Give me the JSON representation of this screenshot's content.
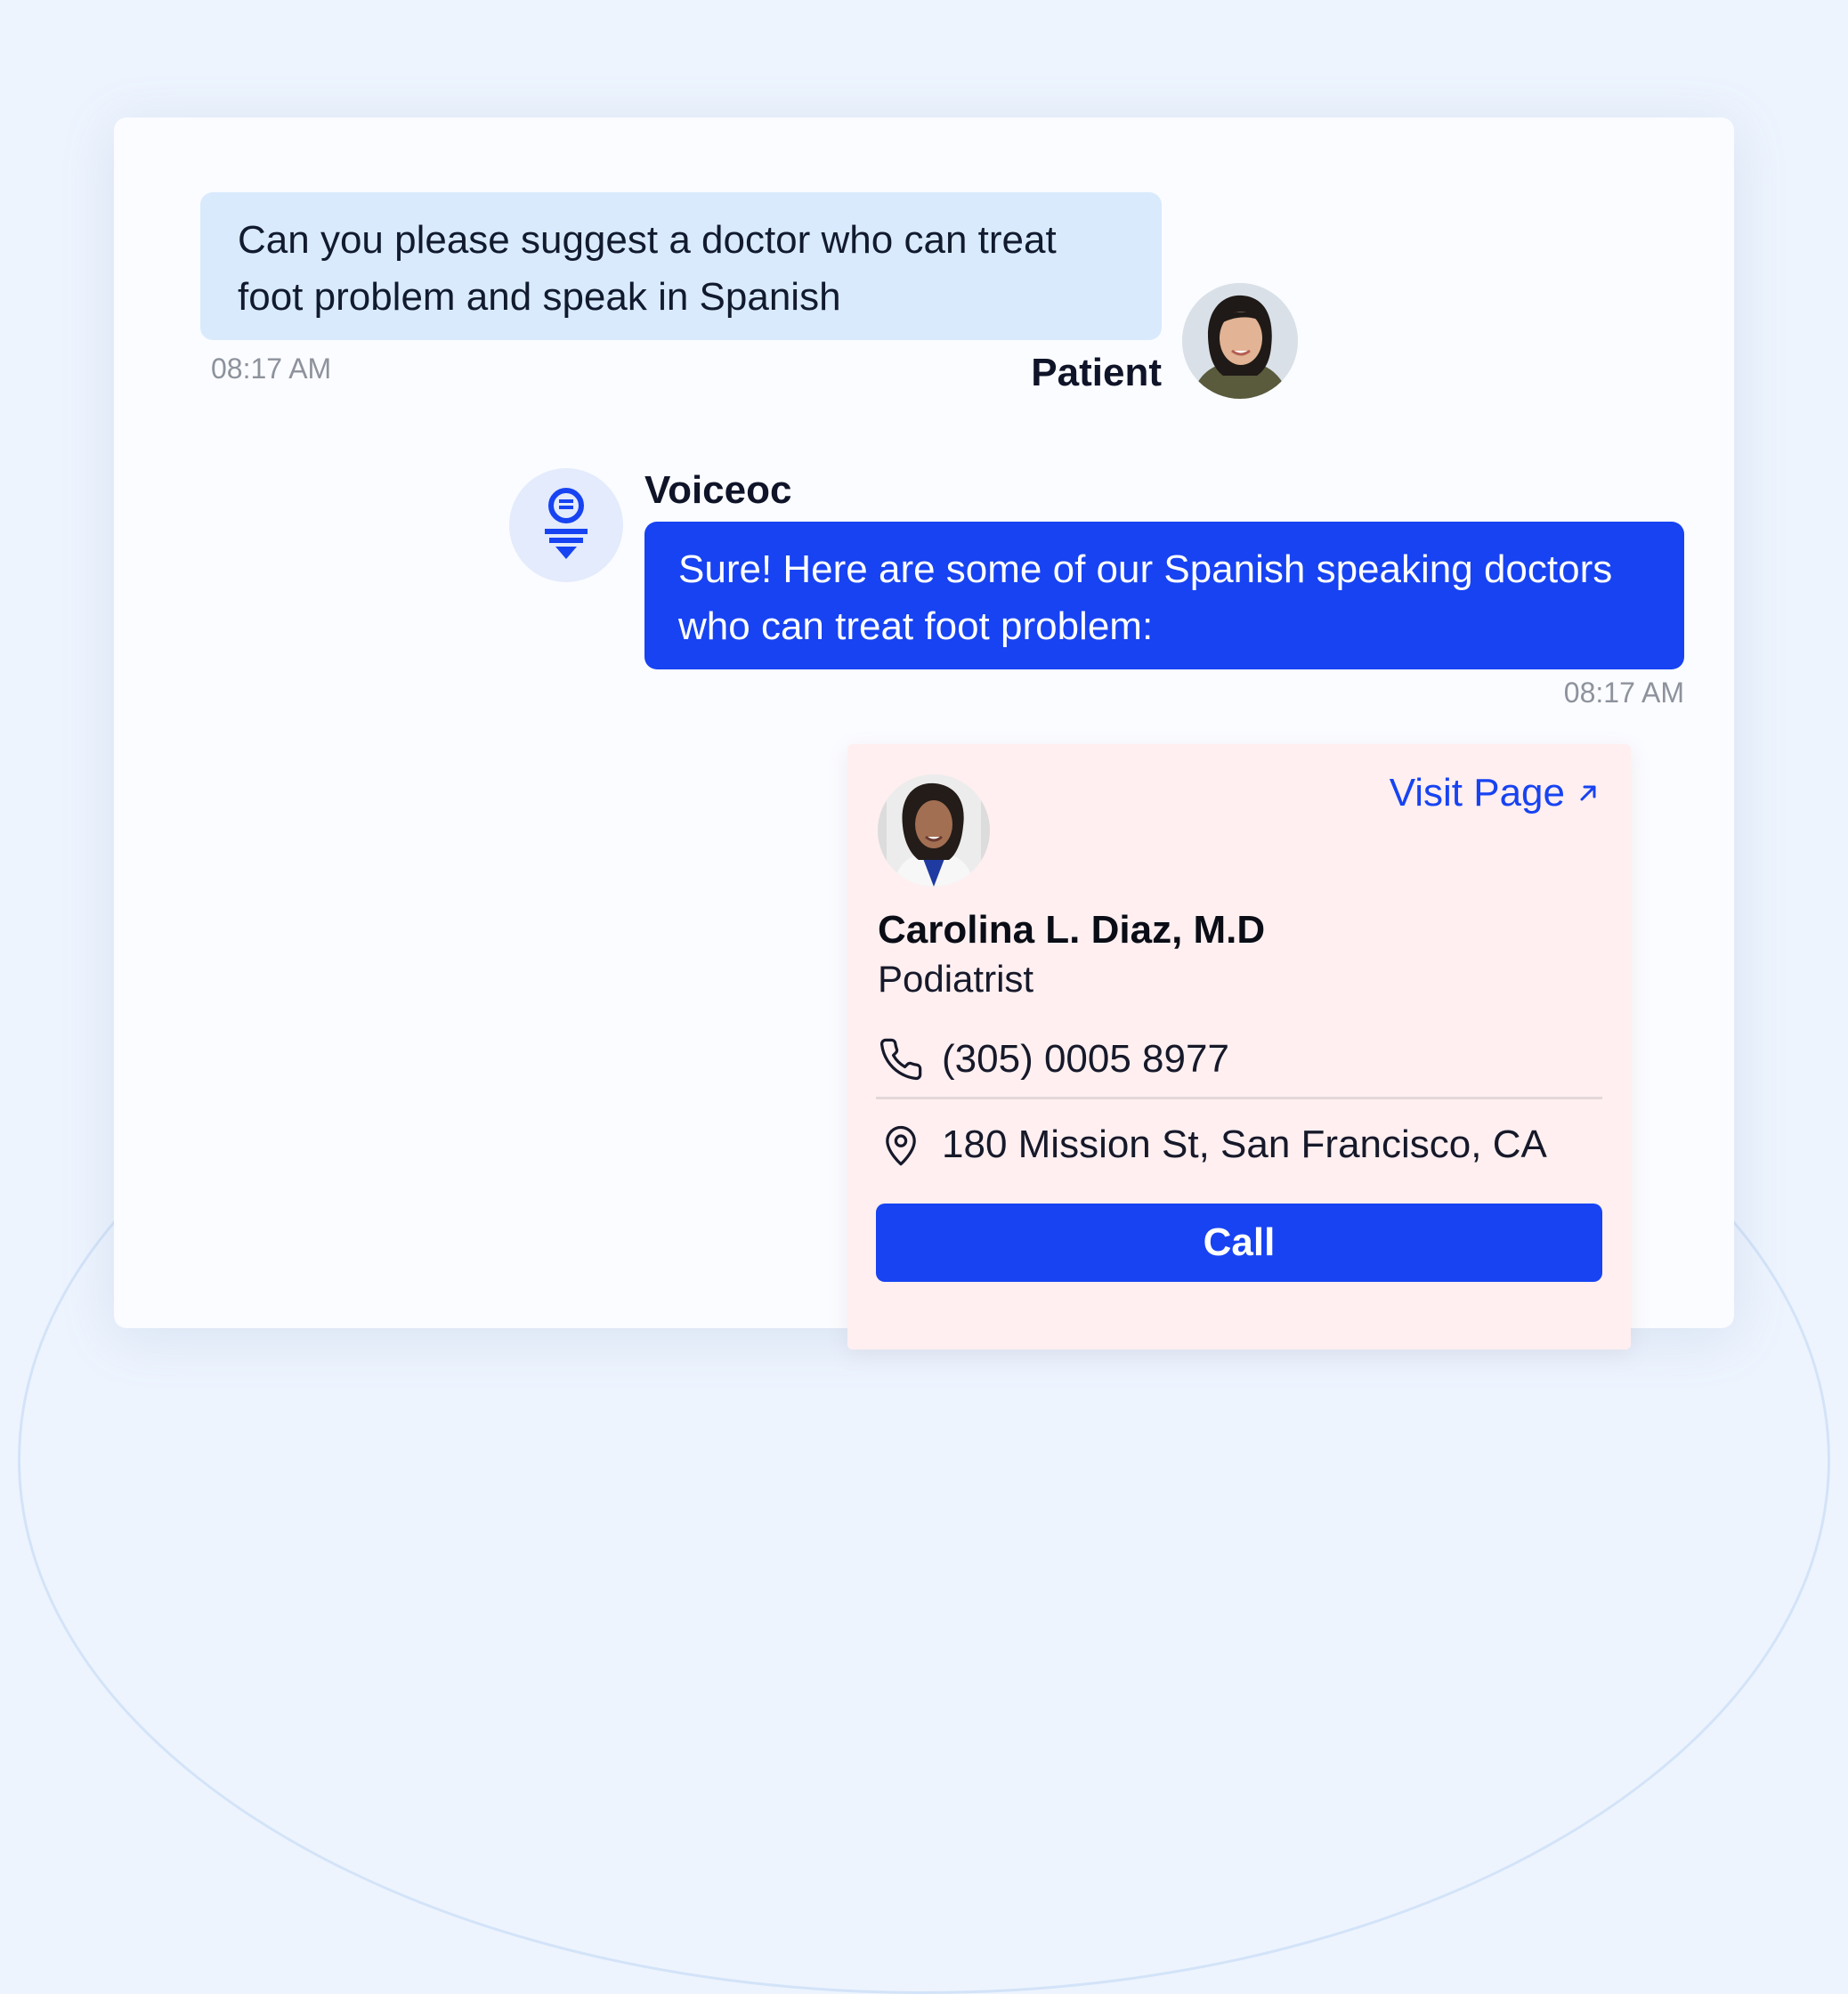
{
  "patient_message": {
    "text": "Can you please suggest a doctor who can treat foot problem and speak in Spanish",
    "time": "08:17 AM",
    "sender": "Patient"
  },
  "bot_message": {
    "sender": "Voiceoc",
    "text": "Sure! Here are some of our Spanish speaking doctors who can treat foot problem:",
    "time": "08:17 AM"
  },
  "doctor_card": {
    "visit_label": "Visit Page",
    "name": "Carolina L. Diaz, M.D",
    "specialty": "Podiatrist",
    "phone": "(305) 0005 8977",
    "address": "180 Mission St, San Francisco, CA",
    "call_label": "Call"
  },
  "icons": [
    "voiceoc-logo-icon",
    "external-link-icon",
    "phone-icon",
    "location-pin-icon"
  ],
  "colors": {
    "accent": "#1743f2",
    "patient_bubble": "#d9eafd",
    "card_background": "#ffeff0",
    "page_background": "#edf4fe"
  }
}
